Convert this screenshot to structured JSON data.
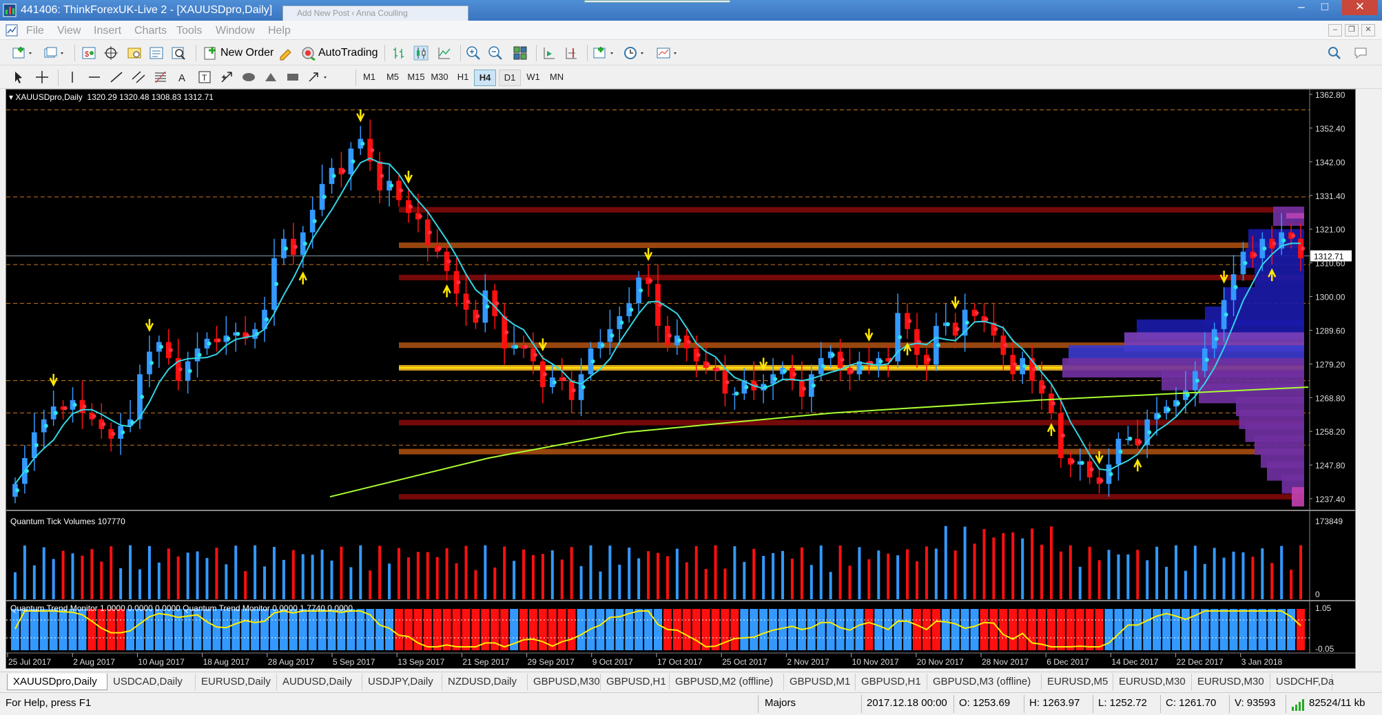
{
  "window": {
    "title": "441406: ThinkForexUK-Live 2 - [XAUUSDpro,Daily]",
    "ghost_tab": "Add New Post ‹ Anna Coulling"
  },
  "menu": [
    "File",
    "View",
    "Insert",
    "Charts",
    "Tools",
    "Window",
    "Help"
  ],
  "toolbar": {
    "new_order_label": "New Order",
    "autotrading_label": "AutoTrading",
    "timeframes": [
      "M1",
      "M5",
      "M15",
      "M30",
      "H1",
      "H4",
      "D1",
      "W1",
      "MN"
    ],
    "active_timeframe": "H4"
  },
  "chart": {
    "symbol_label": "XAUUSDpro,Daily",
    "ohlc_label": "1320.29 1320.48 1308.83 1312.71",
    "current_price": "1312.71",
    "price_axis": [
      "1362.80",
      "1352.40",
      "1342.00",
      "1331.40",
      "1321.00",
      "1310.60",
      "1300.00",
      "1289.60",
      "1279.20",
      "1268.80",
      "1258.20",
      "1247.80",
      "1237.40"
    ],
    "volume_label": "Quantum Tick Volumes 107770",
    "volume_axis_max": "173849",
    "volume_axis_min": "0",
    "trend_label": "Quantum Trend Monitor 1.0000 0.0000 0.0000  Quantum Trend Monitor 0.0000 1.7740 0.0000",
    "trend_axis_max": "1.05",
    "trend_axis_min": "-0.05",
    "date_axis": [
      "25 Jul 2017",
      "2 Aug 2017",
      "10 Aug 2017",
      "18 Aug 2017",
      "28 Aug 2017",
      "5 Sep 2017",
      "13 Sep 2017",
      "21 Sep 2017",
      "29 Sep 2017",
      "9 Oct 2017",
      "17 Oct 2017",
      "25 Oct 2017",
      "2 Nov 2017",
      "10 Nov 2017",
      "20 Nov 2017",
      "28 Nov 2017",
      "6 Dec 2017",
      "14 Dec 2017",
      "22 Dec 2017",
      "3 Jan 2018"
    ],
    "colors": {
      "bull": "#3399ff",
      "bear": "#ff1010",
      "ma_fast": "#33d6e6",
      "ma_slow": "#aaff33",
      "trend_line": "#ffee00"
    }
  },
  "chart_data": {
    "type": "candlestick",
    "symbol": "XAUUSDpro",
    "timeframe": "Daily",
    "ylim": [
      1237.4,
      1362.8
    ],
    "closes": [
      1242,
      1250,
      1258,
      1262,
      1266,
      1265,
      1268,
      1264,
      1262,
      1259,
      1256,
      1260,
      1262,
      1276,
      1283,
      1286,
      1281,
      1274,
      1280,
      1284,
      1287,
      1286,
      1288,
      1289,
      1287,
      1290,
      1296,
      1312,
      1318,
      1313,
      1320,
      1327,
      1335,
      1340,
      1338,
      1346,
      1349,
      1342,
      1333,
      1336,
      1330,
      1326,
      1324,
      1316,
      1314,
      1308,
      1301,
      1296,
      1292,
      1302,
      1294,
      1284,
      1285,
      1284,
      1280,
      1272,
      1275,
      1274,
      1268,
      1276,
      1284,
      1286,
      1290,
      1294,
      1298,
      1306,
      1304,
      1291,
      1285,
      1288,
      1284,
      1280,
      1278,
      1277,
      1270,
      1270,
      1274,
      1271,
      1273,
      1276,
      1278,
      1274,
      1269,
      1276,
      1281,
      1283,
      1278,
      1276,
      1280,
      1279,
      1281,
      1280,
      1295,
      1290,
      1282,
      1279,
      1291,
      1292,
      1288,
      1296,
      1294,
      1292,
      1288,
      1282,
      1276,
      1281,
      1274,
      1270,
      1264,
      1250,
      1248,
      1249,
      1244,
      1242,
      1248,
      1256,
      1256,
      1254,
      1262,
      1264,
      1266,
      1268,
      1271,
      1277,
      1284,
      1290,
      1299,
      1307,
      1314,
      1312,
      1318,
      1315,
      1320,
      1318,
      1312
    ],
    "price_levels": [
      1327,
      1316,
      1306,
      1285,
      1278,
      1261,
      1252,
      1238
    ]
  },
  "tabs": [
    "XAUUSDpro,Daily",
    "USDCAD,Daily",
    "EURUSD,Daily",
    "AUDUSD,Daily",
    "USDJPY,Daily",
    "NZDUSD,Daily",
    "GBPUSD,M30",
    "GBPUSD,H1",
    "GBPUSD,M2 (offline)",
    "GBPUSD,M1",
    "GBPUSD,H1",
    "GBPUSD,M3 (offline)",
    "EURUSD,M5",
    "EURUSD,M30",
    "EURUSD,M30",
    "USDCHF,Da"
  ],
  "status": {
    "help": "For Help, press F1",
    "profile": "Majors",
    "datetime": "2017.12.18 00:00",
    "open": "O: 1253.69",
    "high": "H: 1263.97",
    "low": "L: 1252.72",
    "close": "C: 1261.70",
    "volume": "V: 93593",
    "traffic": "82524/11 kb"
  }
}
